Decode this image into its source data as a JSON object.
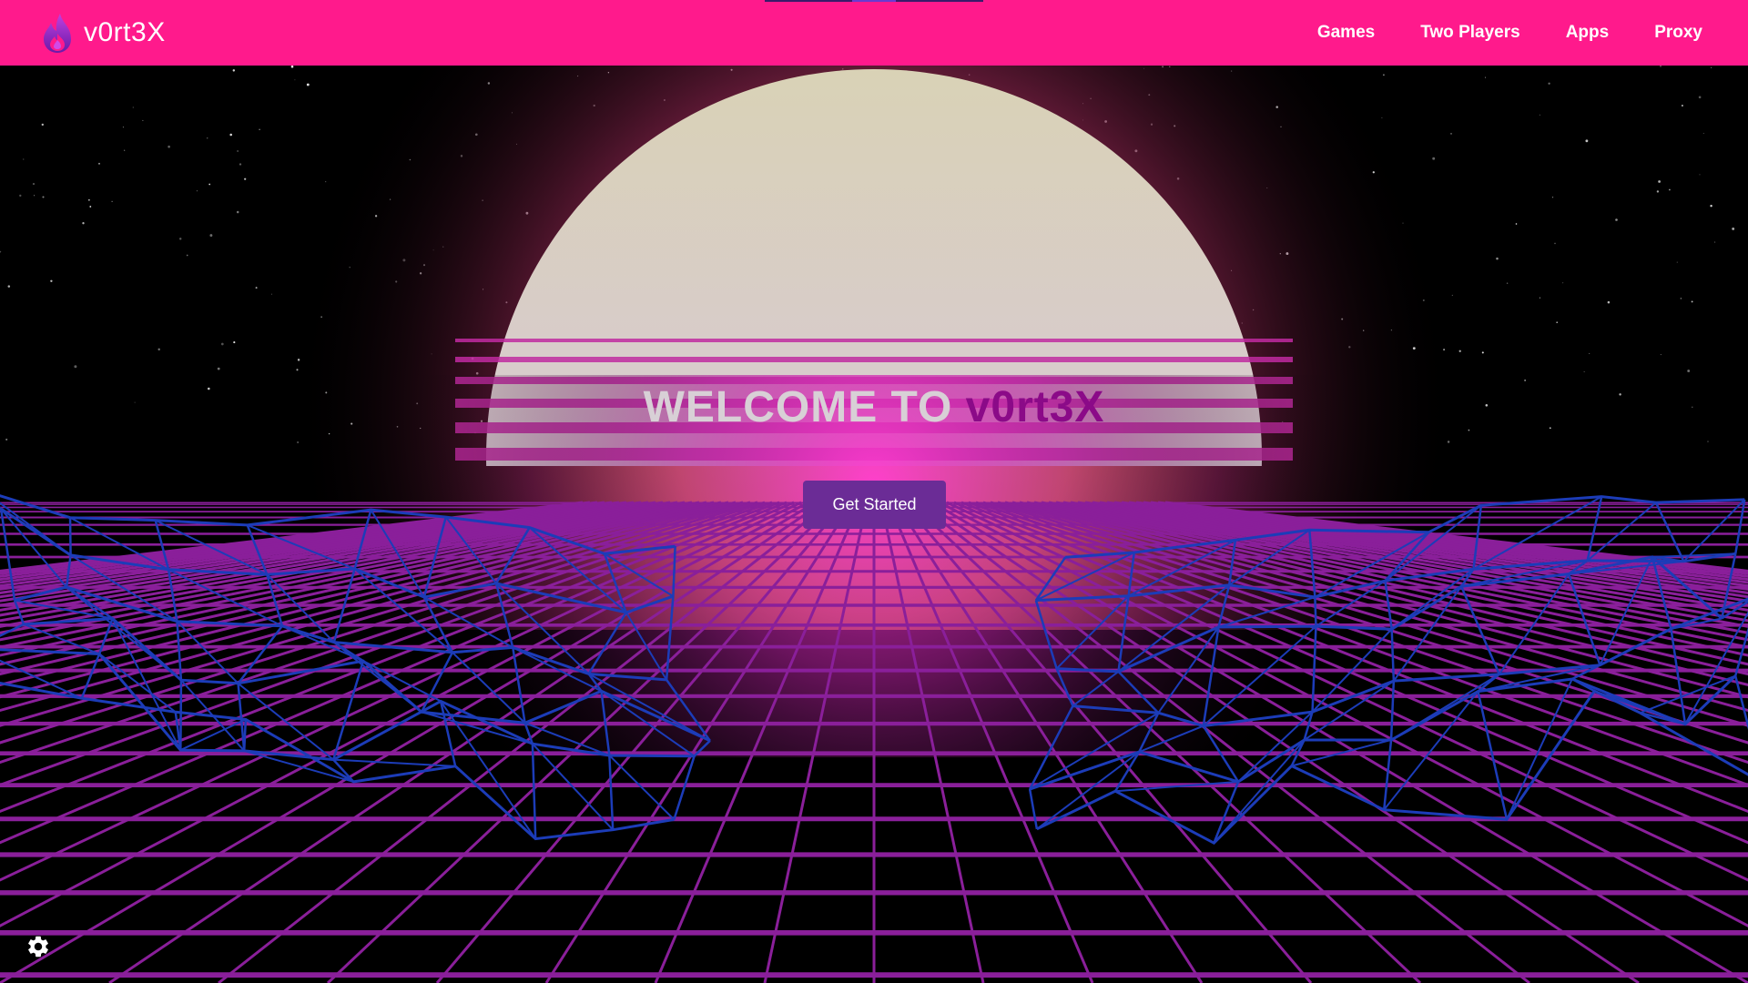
{
  "brand": {
    "name": "v0rt3X",
    "logo_icon": "flame-icon"
  },
  "nav": {
    "links": [
      {
        "label": "Games"
      },
      {
        "label": "Two Players"
      },
      {
        "label": "Apps"
      },
      {
        "label": "Proxy"
      }
    ]
  },
  "hero": {
    "title_prefix": "WELCOME TO ",
    "title_accent": "v0rt3X",
    "cta_label": "Get Started"
  },
  "settings": {
    "icon": "gear-icon"
  },
  "colors": {
    "navbar": "#ff1a8c",
    "accent": "#8b0a88",
    "button": "#6b2c96",
    "grid": "#8a1f9a",
    "mountains": "#1c3cb8"
  }
}
